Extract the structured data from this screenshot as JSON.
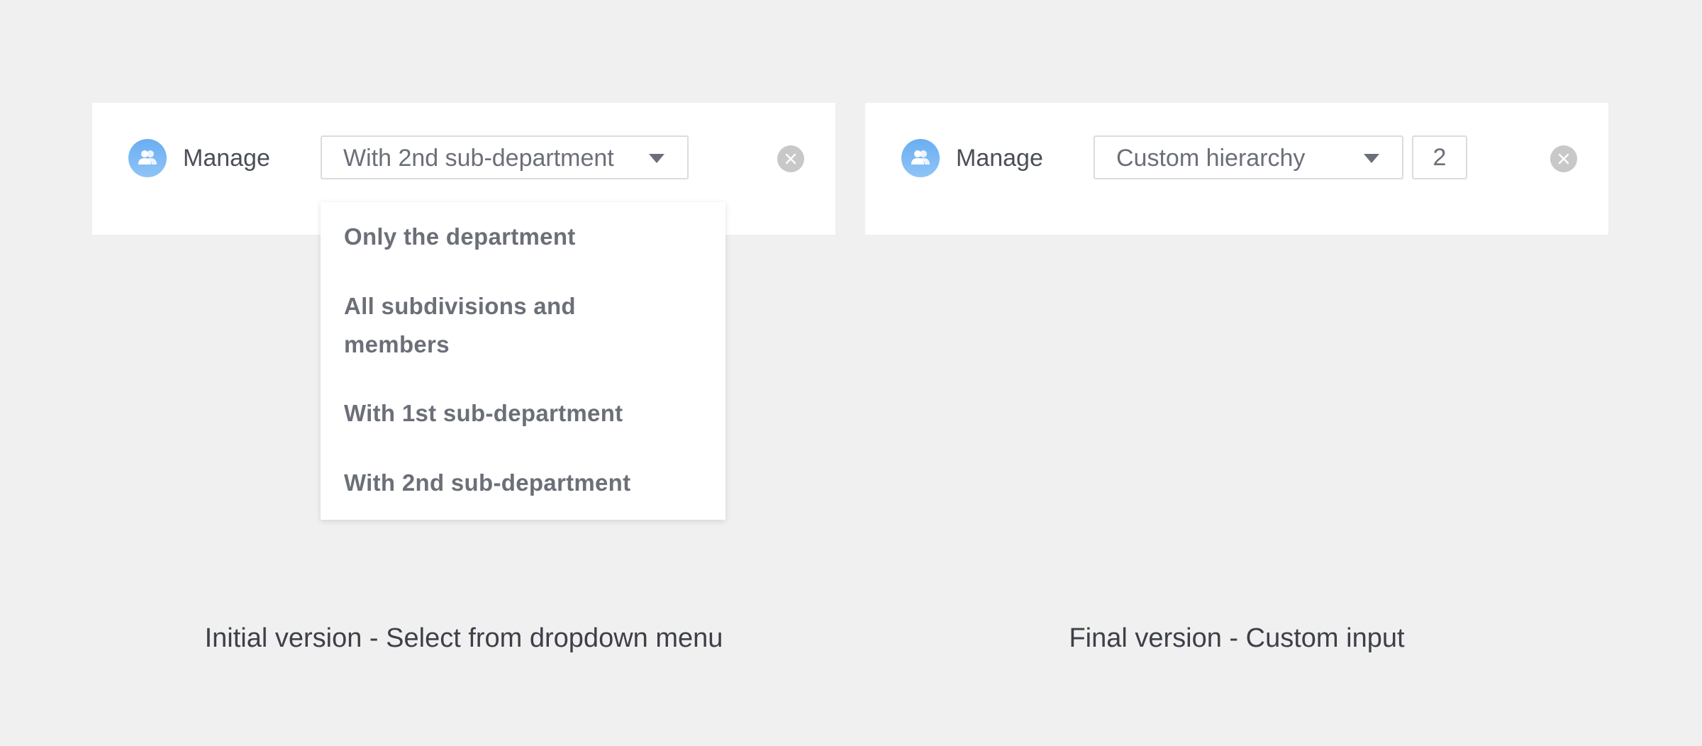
{
  "left_panel": {
    "manage_label": "Manage",
    "select_value": "With 2nd sub-department",
    "dropdown_options": [
      "Only the department",
      "All subdivisions and members",
      "With 1st sub-department",
      "With 2nd sub-department"
    ],
    "caption": "Initial version - Select from dropdown menu"
  },
  "right_panel": {
    "manage_label": "Manage",
    "select_value": "Custom hierarchy",
    "hierarchy_level": "2",
    "caption": "Final version - Custom input"
  },
  "icons": {
    "avatar": "users-icon",
    "caret": "caret-down-icon",
    "clear": "close-circle-icon"
  },
  "colors": {
    "background": "#f0f0f0",
    "panel": "#ffffff",
    "avatar_blue": "#6aaef2",
    "text": "#6b6f78",
    "clear_gray": "#c8c8c8"
  }
}
